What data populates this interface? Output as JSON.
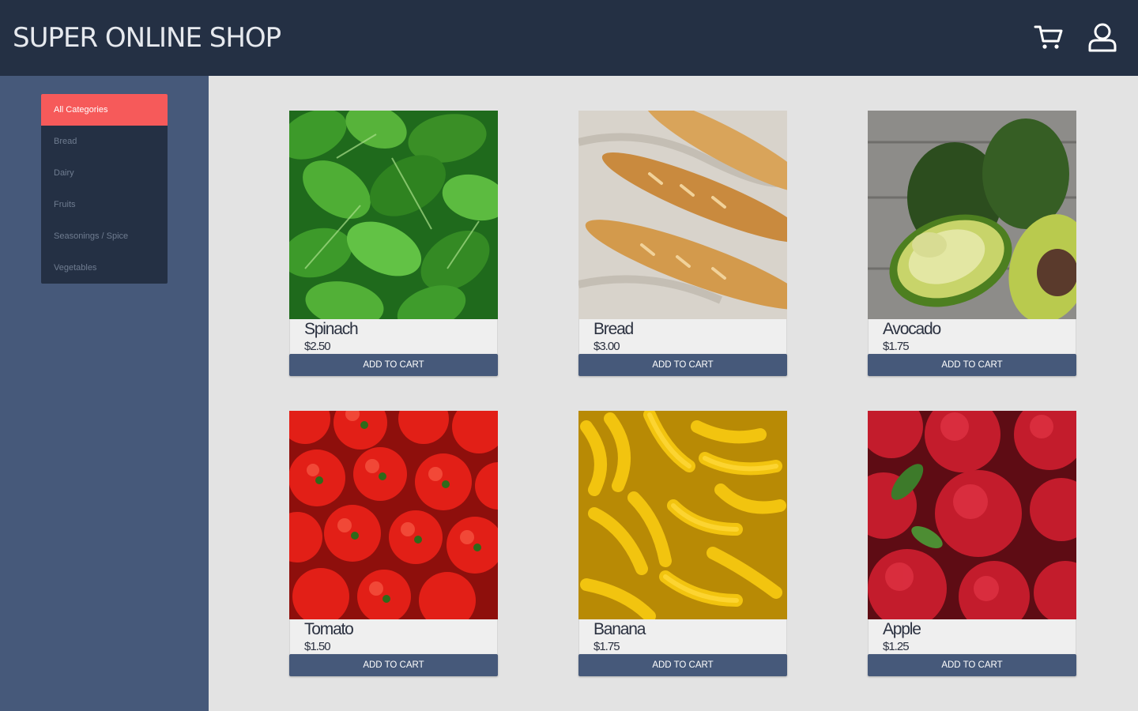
{
  "header": {
    "title": "SUPER ONLINE SHOP",
    "cart_icon": "shopping-cart-icon",
    "account_icon": "user-account-icon"
  },
  "sidebar": {
    "categories": [
      {
        "label": "All Categories",
        "active": true
      },
      {
        "label": "Bread",
        "active": false
      },
      {
        "label": "Dairy",
        "active": false
      },
      {
        "label": "Fruits",
        "active": false
      },
      {
        "label": "Seasonings / Spice",
        "active": false
      },
      {
        "label": "Vegetables",
        "active": false
      }
    ]
  },
  "products": [
    {
      "name": "Spinach",
      "price": "$2.50",
      "button": "ADD TO CART"
    },
    {
      "name": "Bread",
      "price": "$3.00",
      "button": "ADD TO CART"
    },
    {
      "name": "Avocado",
      "price": "$1.75",
      "button": "ADD TO CART"
    },
    {
      "name": "Tomato",
      "price": "$1.50",
      "button": "ADD TO CART"
    },
    {
      "name": "Banana",
      "price": "$1.75",
      "button": "ADD TO CART"
    },
    {
      "name": "Apple",
      "price": "$1.25",
      "button": "ADD TO CART"
    }
  ],
  "colors": {
    "header_bg": "#243044",
    "sidebar_bg": "#46597a",
    "menu_bg": "#243044",
    "active_category": "#f65a5a",
    "content_bg": "#e3e3e3",
    "button_bg": "#46597a"
  }
}
